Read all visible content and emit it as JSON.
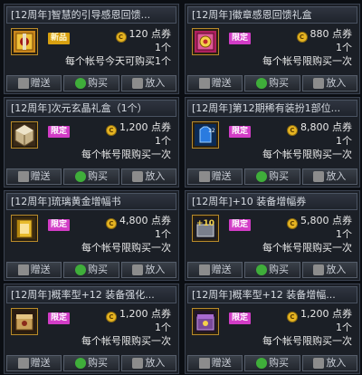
{
  "labels": {
    "currency_unit": "点券",
    "gift": "赠送",
    "buy": "购买",
    "cart": "放入",
    "tag_new": "新品",
    "tag_limit": "限定"
  },
  "items": [
    {
      "title": "[12周年]智慧的引导感恩回馈...",
      "tag": "新品",
      "price": "120",
      "qty": "1个",
      "limit": "每个帐号今天可购买1个",
      "icon": "gold-gift-box-icon"
    },
    {
      "title": "[12周年]徽章感恩回馈礼盒",
      "tag": "限定",
      "price": "880",
      "qty": "1个",
      "limit": "每个帐号限购买一次",
      "icon": "badge-gift-box-icon"
    },
    {
      "title": "[12周年]次元玄晶礼盒（1个）",
      "tag": "限定",
      "price": "1,200",
      "qty": "1个",
      "limit": "每个帐号限购买一次",
      "icon": "crystal-box-icon"
    },
    {
      "title": "[12周年]第12期稀有装扮1部位...",
      "tag": "限定",
      "price": "8,800",
      "qty": "1个",
      "limit": "每个帐号限购买一次",
      "icon": "avatar-outfit-icon"
    },
    {
      "title": "[12周年]琉璃黄金增幅书",
      "tag": "限定",
      "price": "4,800",
      "qty": "1个",
      "limit": "每个帐号限购买一次",
      "icon": "golden-book-icon"
    },
    {
      "title": "[12周年]+10 装备增幅券",
      "tag": "限定",
      "price": "5,800",
      "qty": "1个",
      "limit": "每个帐号限购买一次",
      "icon": "plus10-ticket-icon"
    },
    {
      "title": "[12周年]概率型+12 装备强化...",
      "tag": "限定",
      "price": "1,200",
      "qty": "1个",
      "limit": "每个帐号限购买一次",
      "icon": "enhance-box-icon"
    },
    {
      "title": "[12周年]概率型+12 装备增幅...",
      "tag": "限定",
      "price": "1,200",
      "qty": "1个",
      "limit": "每个帐号限购买一次",
      "icon": "amplify-box-icon"
    }
  ]
}
